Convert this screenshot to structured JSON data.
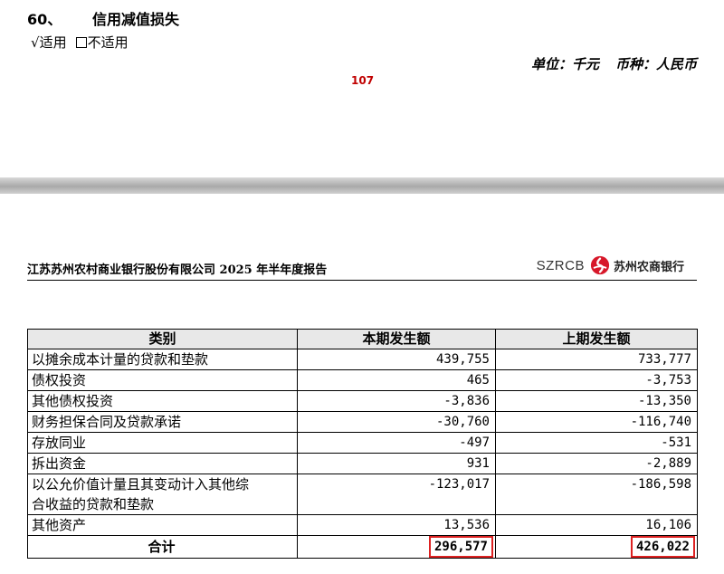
{
  "top_page": {
    "section_number": "60、",
    "section_title": "信用减值损失",
    "applicable_mark": "√",
    "applicable_label": "适用",
    "not_applicable_label": "不适用",
    "unit": "单位：千元",
    "currency": "币种：人民币",
    "page_number": "107"
  },
  "bottom_page": {
    "report_title": "江苏苏州农村商业银行股份有限公司 2025 年半年度报告",
    "brand_code": "SZRCB",
    "brand_name": "苏州农商银行",
    "brand_color": "#d7182a"
  },
  "table": {
    "headers": [
      "类别",
      "本期发生额",
      "上期发生额"
    ],
    "rows": [
      {
        "category": "以摊余成本计量的贷款和垫款",
        "current": "439,755",
        "previous": "733,777"
      },
      {
        "category": "债权投资",
        "current": "465",
        "previous": "-3,753"
      },
      {
        "category": "其他债权投资",
        "current": "-3,836",
        "previous": "-13,350"
      },
      {
        "category": "财务担保合同及贷款承诺",
        "current": "-30,760",
        "previous": "-116,740"
      },
      {
        "category": "存放同业",
        "current": "-497",
        "previous": "-531"
      },
      {
        "category": "拆出资金",
        "current": "931",
        "previous": "-2,889"
      },
      {
        "category_line1": "以公允价值计量且其变动计入其他综",
        "category_line2": "合收益的贷款和垫款",
        "current": "-123,017",
        "previous": "-186,598"
      },
      {
        "category": "其他资产",
        "current": "13,536",
        "previous": "16,106"
      }
    ],
    "total": {
      "label": "合计",
      "current": "296,577",
      "previous": "426,022"
    },
    "highlight_color": "#dd2222"
  }
}
